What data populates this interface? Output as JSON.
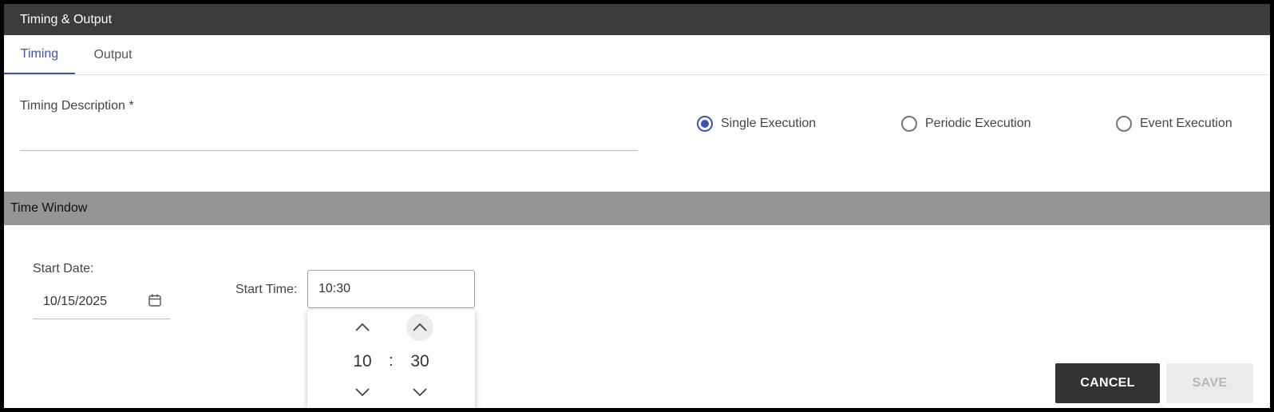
{
  "dialog": {
    "title": "Timing & Output"
  },
  "tabs": [
    {
      "label": "Timing",
      "active": true
    },
    {
      "label": "Output",
      "active": false
    }
  ],
  "timing": {
    "description_label": "Timing Description *",
    "description_value": "",
    "execution_options": [
      {
        "label": "Single Execution",
        "checked": true
      },
      {
        "label": "Periodic Execution",
        "checked": false
      },
      {
        "label": "Event Execution",
        "checked": false
      }
    ]
  },
  "time_window": {
    "header": "Time Window",
    "start_date_label": "Start Date:",
    "start_date_value": "10/15/2025",
    "start_time_label": "Start Time:",
    "start_time_value": "10:30",
    "picker": {
      "hours": "10",
      "separator": ":",
      "minutes": "30"
    }
  },
  "actions": {
    "cancel_label": "CANCEL",
    "save_label": "SAVE",
    "save_disabled": true
  },
  "colors": {
    "accent": "#3f51b5",
    "titlebar": "#3c3c3c",
    "section_header": "#959595",
    "cancel_bg": "#333333"
  }
}
